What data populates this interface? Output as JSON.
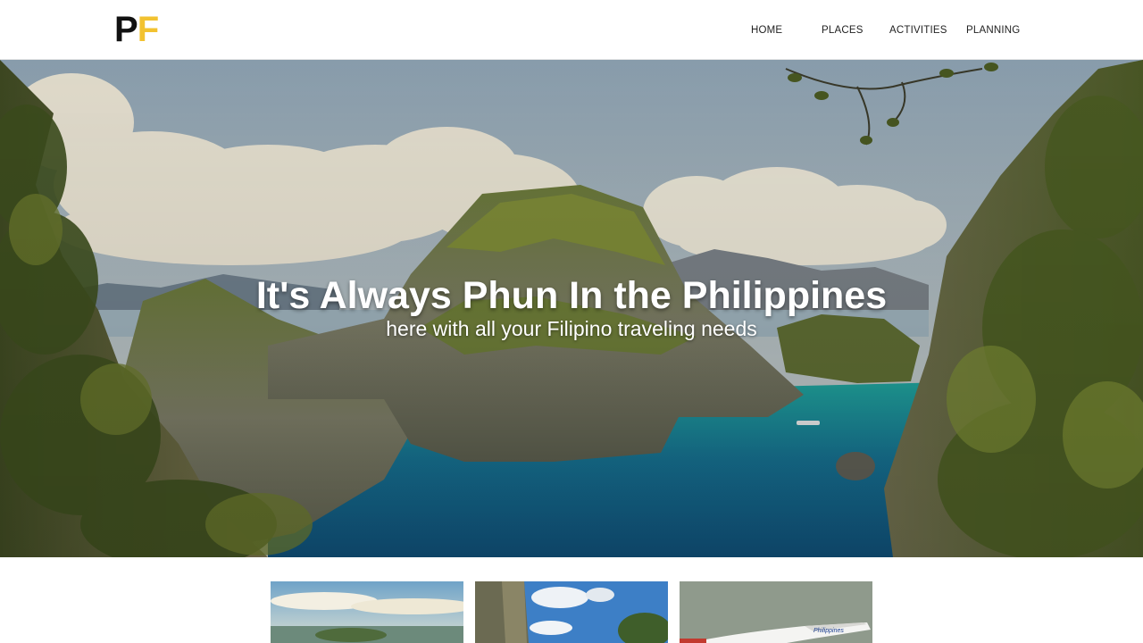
{
  "brand": {
    "logo_first": "P",
    "logo_second": "F",
    "colors": {
      "primary": "#111111",
      "accent": "#f2c230"
    }
  },
  "nav": {
    "items": [
      {
        "label": "HOME"
      },
      {
        "label": "PLACES"
      },
      {
        "label": "ACTIVITIES"
      },
      {
        "label": "PLANNING"
      }
    ]
  },
  "hero": {
    "title": "It's Always Phun In the Philippines",
    "subtitle": "here with all your Filipino traveling needs",
    "image": "tropical-lagoon-limestone-cliffs"
  },
  "cards": [
    {
      "image": "coastal-landscape"
    },
    {
      "image": "island-rock-blue-sky"
    },
    {
      "image": "philippine-airlines-plane",
      "caption": "Philippines"
    }
  ]
}
